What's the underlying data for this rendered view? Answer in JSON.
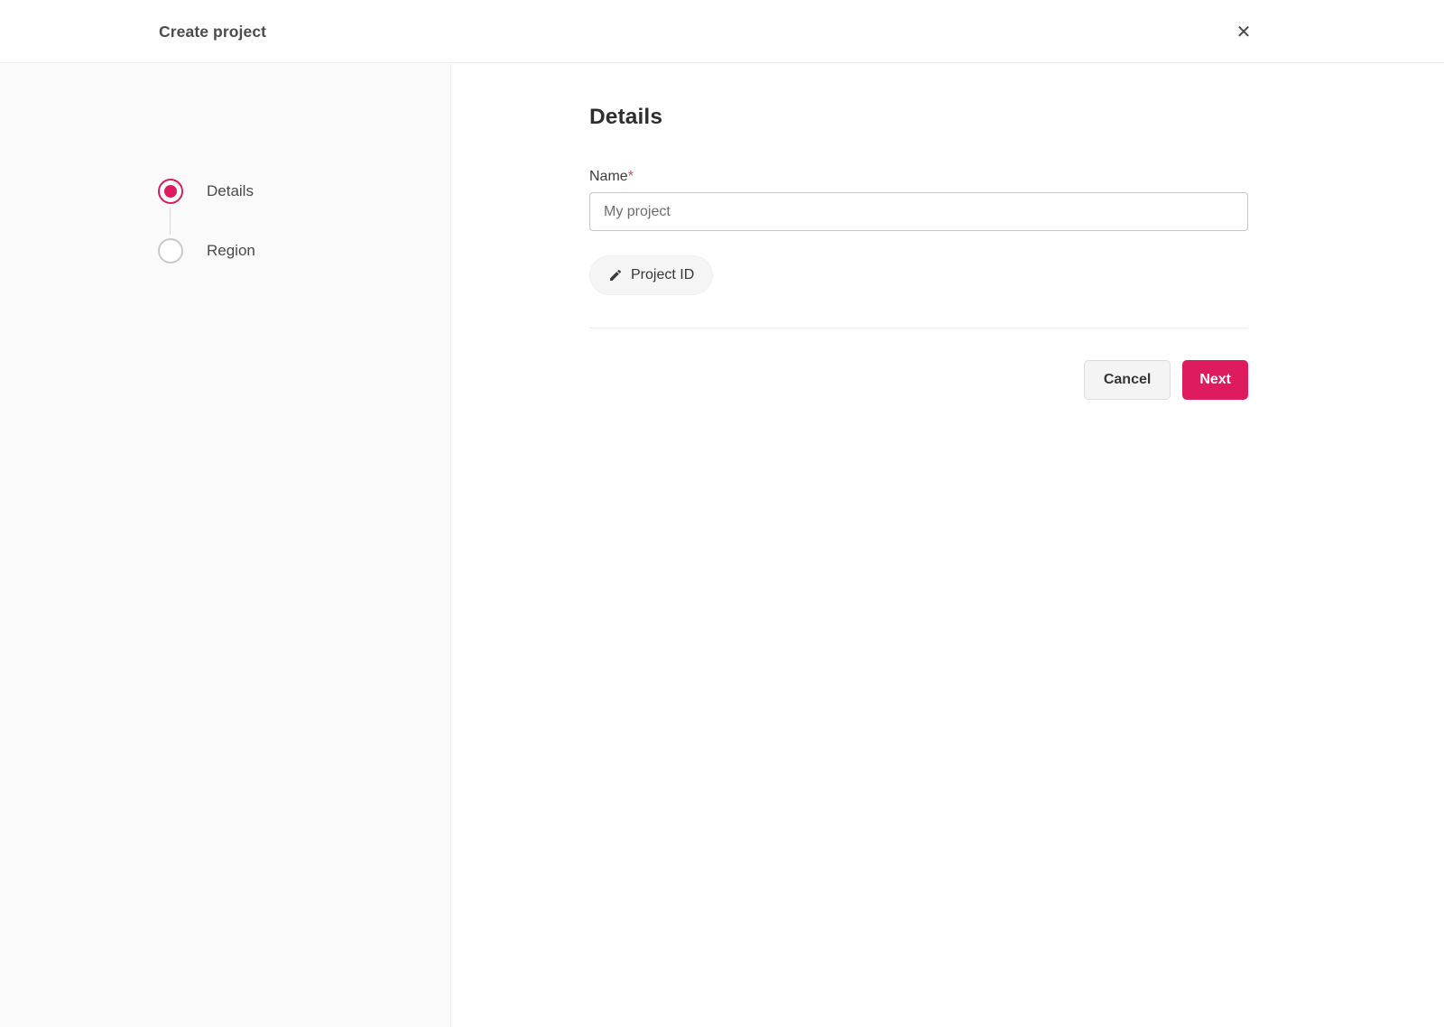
{
  "modal": {
    "title": "Create project",
    "close_glyph": "✕"
  },
  "stepper": {
    "steps": [
      {
        "label": "Details",
        "state": "active"
      },
      {
        "label": "Region",
        "state": "inactive"
      }
    ]
  },
  "form": {
    "heading": "Details",
    "name_label": "Name",
    "required_marker": "*",
    "name_placeholder": "My project",
    "name_value": "",
    "project_id_button_label": "Project ID"
  },
  "footer": {
    "cancel_label": "Cancel",
    "next_label": "Next"
  },
  "colors": {
    "accent": "#dd1b5e",
    "required_marker": "#e5484d",
    "sidebar_background": "#fafafa",
    "border": "#ececec",
    "next_button_background": "#dd1b5e",
    "next_button_text": "#ffffff"
  }
}
